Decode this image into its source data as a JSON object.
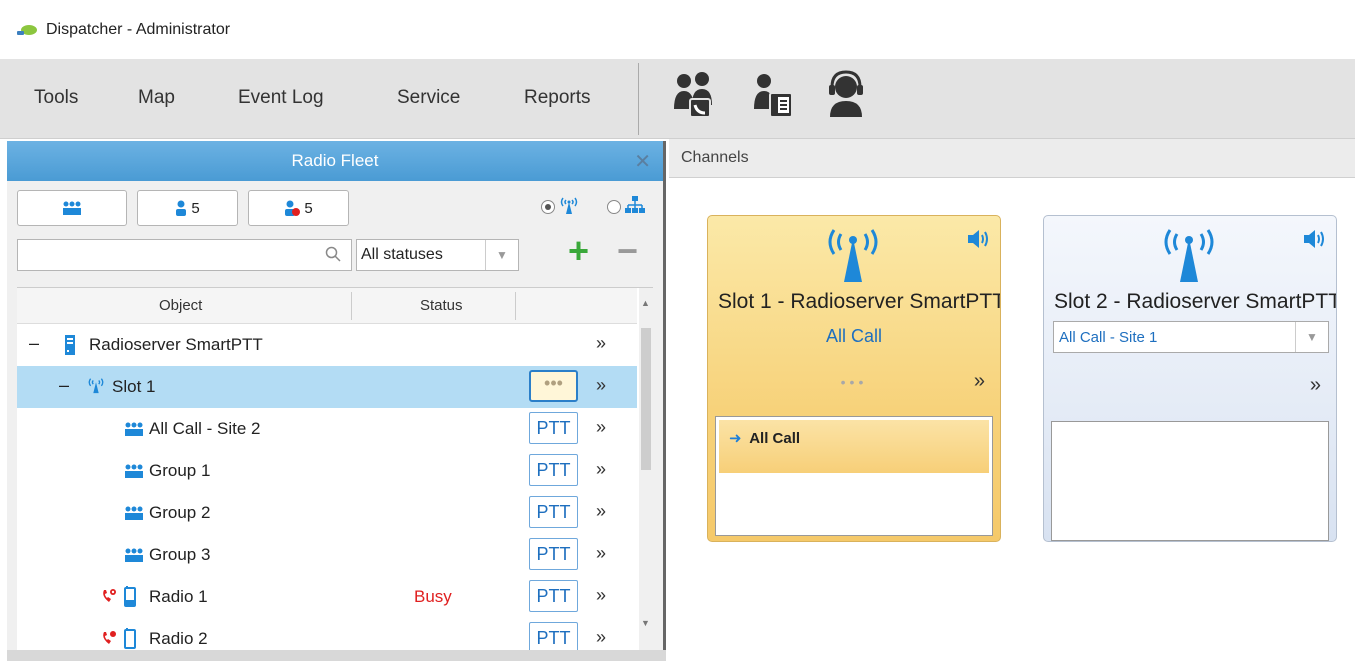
{
  "window": {
    "title": "Dispatcher - Administrator"
  },
  "menu": {
    "items": [
      "Tools",
      "Map",
      "Event Log",
      "Service",
      "Reports"
    ]
  },
  "toolbar_icons": [
    "talkgroup-call-icon",
    "telephone-subscriber-icon",
    "operator-headset-icon"
  ],
  "radio_fleet": {
    "title": "Radio Fleet",
    "close": "✕",
    "filters": {
      "talkgroups_label": "",
      "online_count": "5",
      "offline_count": "5"
    },
    "search": {
      "placeholder": "",
      "value": ""
    },
    "status_filter": {
      "selected": "All statuses"
    },
    "columns": [
      "Object",
      "Status"
    ],
    "rows": [
      {
        "label": "Radioserver SmartPTT",
        "expander": "–",
        "status": "",
        "action": ""
      },
      {
        "label": "Slot 1",
        "expander": "–",
        "status": "",
        "action": "•••"
      },
      {
        "label": "All Call - Site 2",
        "status": "",
        "action": "PTT"
      },
      {
        "label": "Group 1",
        "status": "",
        "action": "PTT"
      },
      {
        "label": "Group 2",
        "status": "",
        "action": "PTT"
      },
      {
        "label": "Group 3",
        "status": "",
        "action": "PTT"
      },
      {
        "label": "Radio 1",
        "status": "Busy",
        "action": "PTT"
      },
      {
        "label": "Radio 2",
        "status": "",
        "action": "PTT"
      }
    ],
    "chevron": "»"
  },
  "channels": {
    "title": "Channels",
    "cards": [
      {
        "name": "Slot 1 - Radioserver SmartPTT",
        "call": "All Call",
        "dots": "•••",
        "active_call": "All Call"
      },
      {
        "name": "Slot 2 - Radioserver SmartPTT",
        "selected": "All Call - Site 1"
      }
    ]
  },
  "colors": {
    "accent": "#4a9bd4",
    "ptt": "#1e6fbf",
    "busy": "#e02020",
    "card_active": "#f7cf78",
    "card_idle": "#dfe7f3"
  }
}
